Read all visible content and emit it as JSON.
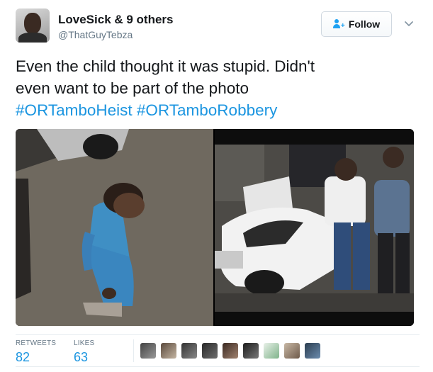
{
  "user": {
    "name": "LoveSick & 9 others",
    "handle": "@ThatGuyTebza"
  },
  "actions": {
    "follow_label": "Follow"
  },
  "tweet": {
    "text_line1": "Even the child thought it was stupid. Didn't",
    "text_line2": "even want to be part of the photo",
    "hashtags": [
      "#ORTamboHeist",
      "#ORTamboRobbery"
    ]
  },
  "stats": {
    "retweets_label": "RETWEETS",
    "retweets_count": "82",
    "likes_label": "LIKES",
    "likes_count": "63"
  },
  "colors": {
    "text": "#14171a",
    "secondary": "#657786",
    "link": "#1b95e0",
    "accent": "#1da1f2"
  },
  "icons": [
    "follow-person-icon",
    "chevron-down-icon"
  ]
}
